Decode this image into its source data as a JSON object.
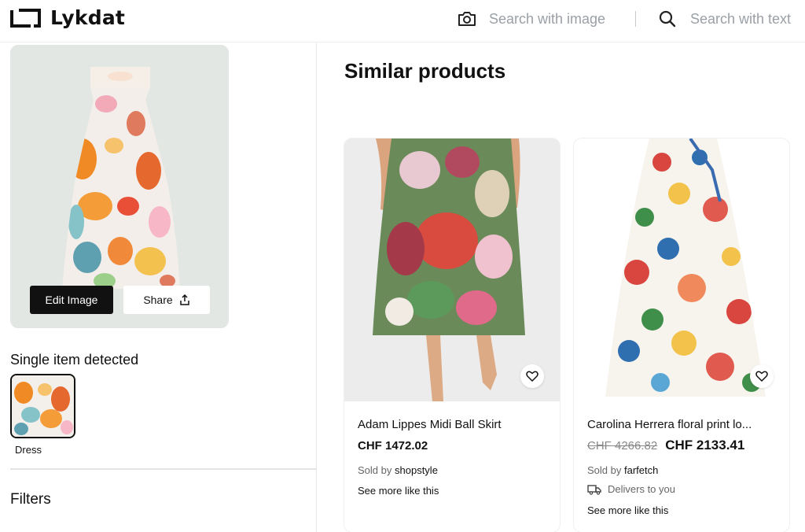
{
  "header": {
    "brand": "Lykdat",
    "search_image_label": "Search with image",
    "search_text_label": "Search with text"
  },
  "query": {
    "edit_label": "Edit Image",
    "share_label": "Share",
    "detected_title": "Single item detected",
    "item_label": "Dress",
    "filters_label": "Filters"
  },
  "main": {
    "title": "Similar products",
    "products": [
      {
        "name": "Adam Lippes Midi Ball Skirt",
        "price": "CHF 1472.02",
        "sold_by_prefix": "Sold by",
        "seller": "shopstyle",
        "see_more": "See more like this"
      },
      {
        "name": "Carolina Herrera floral print lo...",
        "old_price": "CHF 4266.82",
        "price": "CHF 2133.41",
        "sold_by_prefix": "Sold by",
        "seller": "farfetch",
        "delivers": "Delivers to you",
        "see_more": "See more like this"
      }
    ]
  },
  "icons": [
    "logo-mark",
    "camera-icon",
    "search-icon",
    "share-icon",
    "heart-icon",
    "truck-icon"
  ]
}
